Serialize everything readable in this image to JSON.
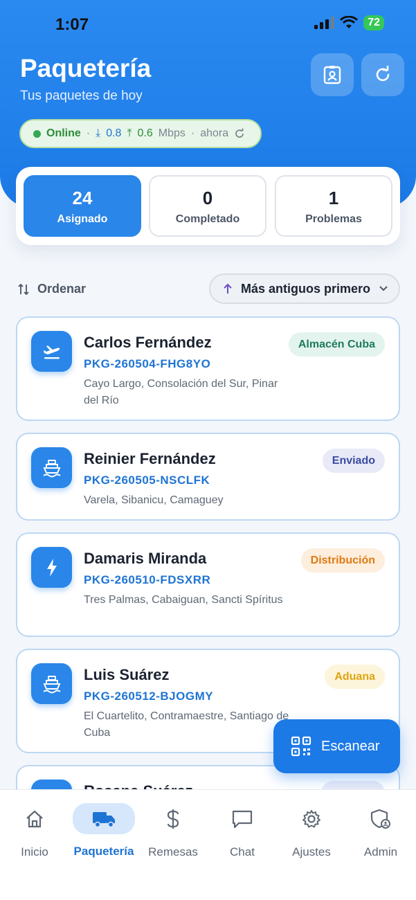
{
  "status_bar": {
    "time": "1:07",
    "battery": "72"
  },
  "header": {
    "title": "Paquetería",
    "subtitle": "Tus paquetes de hoy",
    "network": {
      "status": "Online",
      "down": "0.8",
      "up": "0.6",
      "unit": "Mbps",
      "updated": "ahora",
      "sep": "·"
    }
  },
  "stats": [
    {
      "value": "24",
      "label": "Asignado"
    },
    {
      "value": "0",
      "label": "Completado"
    },
    {
      "value": "1",
      "label": "Problemas"
    }
  ],
  "sort": {
    "label": "Ordenar",
    "value": "Más antiguos primero"
  },
  "packages": [
    {
      "name": "Carlos Fernández",
      "code": "PKG-260504-FHG8YO",
      "address": "Cayo Largo, Consolación del Sur, Pinar del Río",
      "status": "Almacén Cuba",
      "icon": "plane-icon"
    },
    {
      "name": "Reinier Fernández",
      "code": "PKG-260505-NSCLFK",
      "address": "Varela, Sibanicu, Camaguey",
      "status": "Enviado",
      "icon": "ship-icon"
    },
    {
      "name": "Damaris Miranda",
      "code": "PKG-260510-FDSXRR",
      "address": "Tres Palmas, Cabaiguan, Sancti Spíritus",
      "status": "Distribución",
      "icon": "bolt-icon"
    },
    {
      "name": "Luis Suárez",
      "code": "PKG-260512-BJOGMY",
      "address": "El Cuartelito, Contramaestre, Santiago de Cuba",
      "status": "Aduana",
      "icon": "ship-icon"
    },
    {
      "name": "Rosana Suárez",
      "code": "",
      "address": "",
      "status": "",
      "icon": "plane-icon"
    }
  ],
  "fab": {
    "label": "Escanear"
  },
  "tabs": [
    {
      "label": "Inicio",
      "icon": "home-icon"
    },
    {
      "label": "Paquetería",
      "icon": "truck-icon"
    },
    {
      "label": "Remesas",
      "icon": "dollar-icon"
    },
    {
      "label": "Chat",
      "icon": "chat-icon"
    },
    {
      "label": "Ajustes",
      "icon": "gear-icon"
    },
    {
      "label": "Admin",
      "icon": "admin-shield-icon"
    }
  ],
  "colors": {
    "primary": "#1c7ae6",
    "badge_almacen": "#e3f4ef",
    "badge_enviado": "#e8eaf7",
    "badge_distribucion": "#fdeedd",
    "badge_aduana": "#fdf5db"
  }
}
